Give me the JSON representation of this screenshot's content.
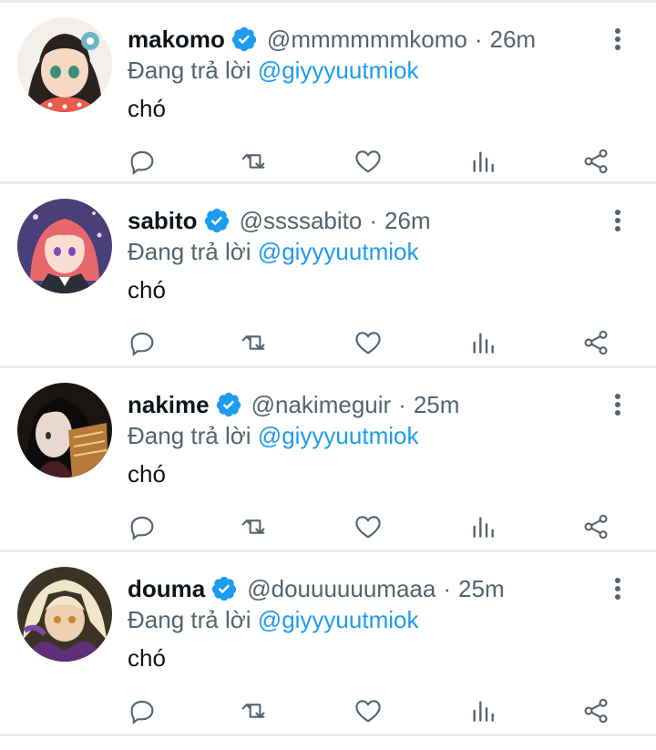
{
  "colors": {
    "accent": "#1d9bf0",
    "muted": "#536471",
    "divider": "#e6ecf0"
  },
  "tweets": [
    {
      "name": "makomo",
      "handle": "@mmmmmmkomo",
      "separator": "·",
      "time": "26m",
      "reply_prefix": "Đang trả lời",
      "reply_to": "@giyyyuutmiok",
      "text": "chó"
    },
    {
      "name": "sabito",
      "handle": "@ssssabito",
      "separator": "·",
      "time": "26m",
      "reply_prefix": "Đang trả lời",
      "reply_to": "@giyyyuutmiok",
      "text": "chó"
    },
    {
      "name": "nakime",
      "handle": "@nakimeguir",
      "separator": "·",
      "time": "25m",
      "reply_prefix": "Đang trả lời",
      "reply_to": "@giyyyuutmiok",
      "text": "chó"
    },
    {
      "name": "douma",
      "handle": "@douuuuuumaaa",
      "separator": "·",
      "time": "25m",
      "reply_prefix": "Đang trả lời",
      "reply_to": "@giyyyuutmiok",
      "text": "chó"
    }
  ],
  "icons": {
    "verified": "verified-badge-icon",
    "more": "more-vertical-icon",
    "reply": "reply-icon",
    "retweet": "retweet-icon",
    "like": "heart-icon",
    "stats": "analytics-icon",
    "share": "share-icon"
  }
}
